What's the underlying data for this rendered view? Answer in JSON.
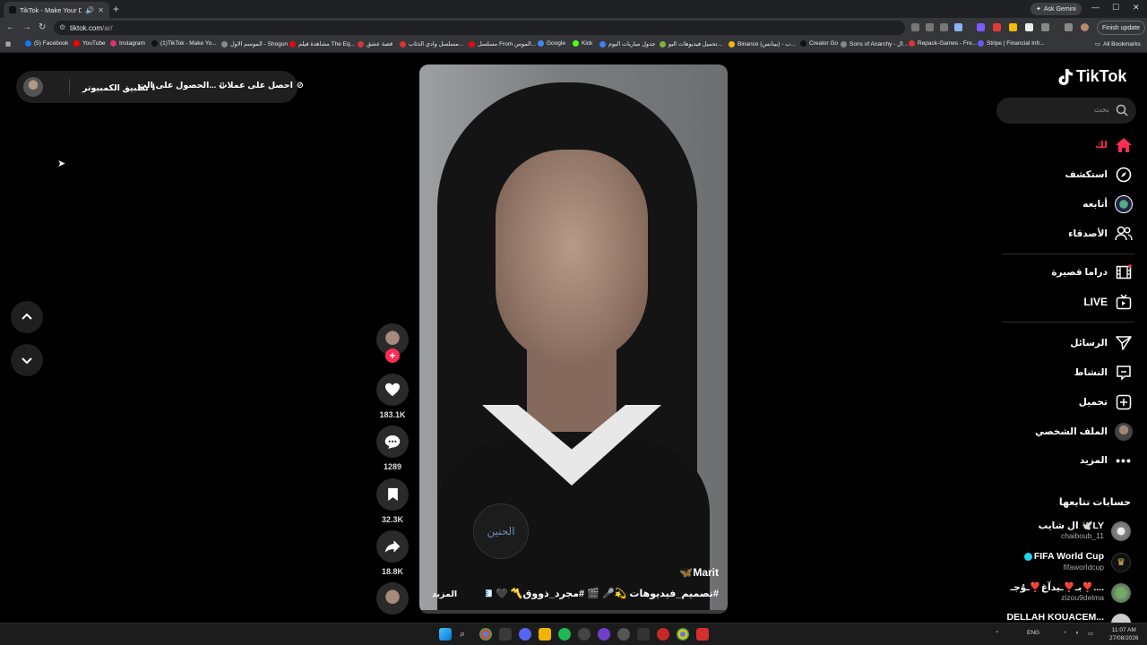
{
  "browser": {
    "tab_title": "TikTok - Make Your Day",
    "new_tab": "+",
    "gemini_label": "Ask Gemini",
    "url_domain": "tiktok.com",
    "url_path": "/ar/",
    "finish_update": "Finish update",
    "all_bookmarks": "All Bookmarks",
    "bookmarks": [
      {
        "label": "(5) Facebook",
        "color": "#1877f2"
      },
      {
        "label": "YouTube",
        "color": "#ff0000"
      },
      {
        "label": "Instagram",
        "color": "#e1306c"
      },
      {
        "label": "(1)TikTok - Make Yo...",
        "color": "#111111"
      },
      {
        "label": "الموسم الاول - Shogun",
        "color": "#888888"
      },
      {
        "label": "مشاهدة فيلم The Eq...",
        "color": "#e50914"
      },
      {
        "label": "قصة عشق",
        "color": "#d33"
      },
      {
        "label": "مسلسل وادي الذئاب...",
        "color": "#d33"
      },
      {
        "label": "مسلسل From الموس...",
        "color": "#e50914"
      },
      {
        "label": "Google",
        "color": "#4285f4"
      },
      {
        "label": "Kick",
        "color": "#53fc18"
      },
      {
        "label": "جدول مباريات اليوم",
        "color": "#3b82f6"
      },
      {
        "label": "تحميل فيديوهات اليو...",
        "color": "#7cb342"
      },
      {
        "label": "Binance (بينانس) - ب...",
        "color": "#f0b90b"
      },
      {
        "label": "Creator Go",
        "color": "#111111"
      },
      {
        "label": "Sons of Anarchy - ال...",
        "color": "#888888"
      },
      {
        "label": "Repack-Games - Fre...",
        "color": "#d33"
      },
      {
        "label": "Stripe | Financial Infr...",
        "color": "#635bff"
      }
    ]
  },
  "topbar": {
    "get_coins": "احصل على عملات",
    "get_app": "الحصول على الت...",
    "desktop_app": "تطبيق الكمبيوتر"
  },
  "video": {
    "title": "Marit🦋",
    "tags": "#تصميم_فيديوهات 💫🎤 🎬 #مجرد_ذووق〽️ 🖤 📧 #حالات ...",
    "more": "المزيد",
    "badge_text": "الحنين"
  },
  "actions": {
    "likes": "183.1K",
    "comments": "1289",
    "saves": "32.3K",
    "shares": "18.8K"
  },
  "sidebar": {
    "logo": "TikTok",
    "search_placeholder": "بحث",
    "nav": {
      "for_you": "لك",
      "explore": "استكشف",
      "following": "أتابعه",
      "friends": "الأصدقاء",
      "drama": "دراما قصيرة",
      "live": "LIVE",
      "messages": "الرسائل",
      "activity": "النشاط",
      "upload": "تحميل",
      "profile": "الملف الشخصي",
      "more": "المزيد"
    },
    "following_header": "حسابات تتابعها",
    "following_accounts": [
      {
        "name": "ال شايب 🕊️LY",
        "handle": "chaiboub_11"
      },
      {
        "name": "FIFA World Cup",
        "handle": "fifaworldcup"
      },
      {
        "name": "بـ❣️ـيدآغ❣️ـوُجـ❣️....",
        "handle": "zizou9delma"
      },
      {
        "name": "DELLAH KOUACEM...",
        "handle": ""
      }
    ]
  },
  "taskbar": {
    "lang": "ENG",
    "time": "11:07 AM",
    "date": "27/08/2026"
  },
  "colors": {
    "accent": "#fe2c55",
    "background": "#000000",
    "surface": "#1f1f1f"
  }
}
